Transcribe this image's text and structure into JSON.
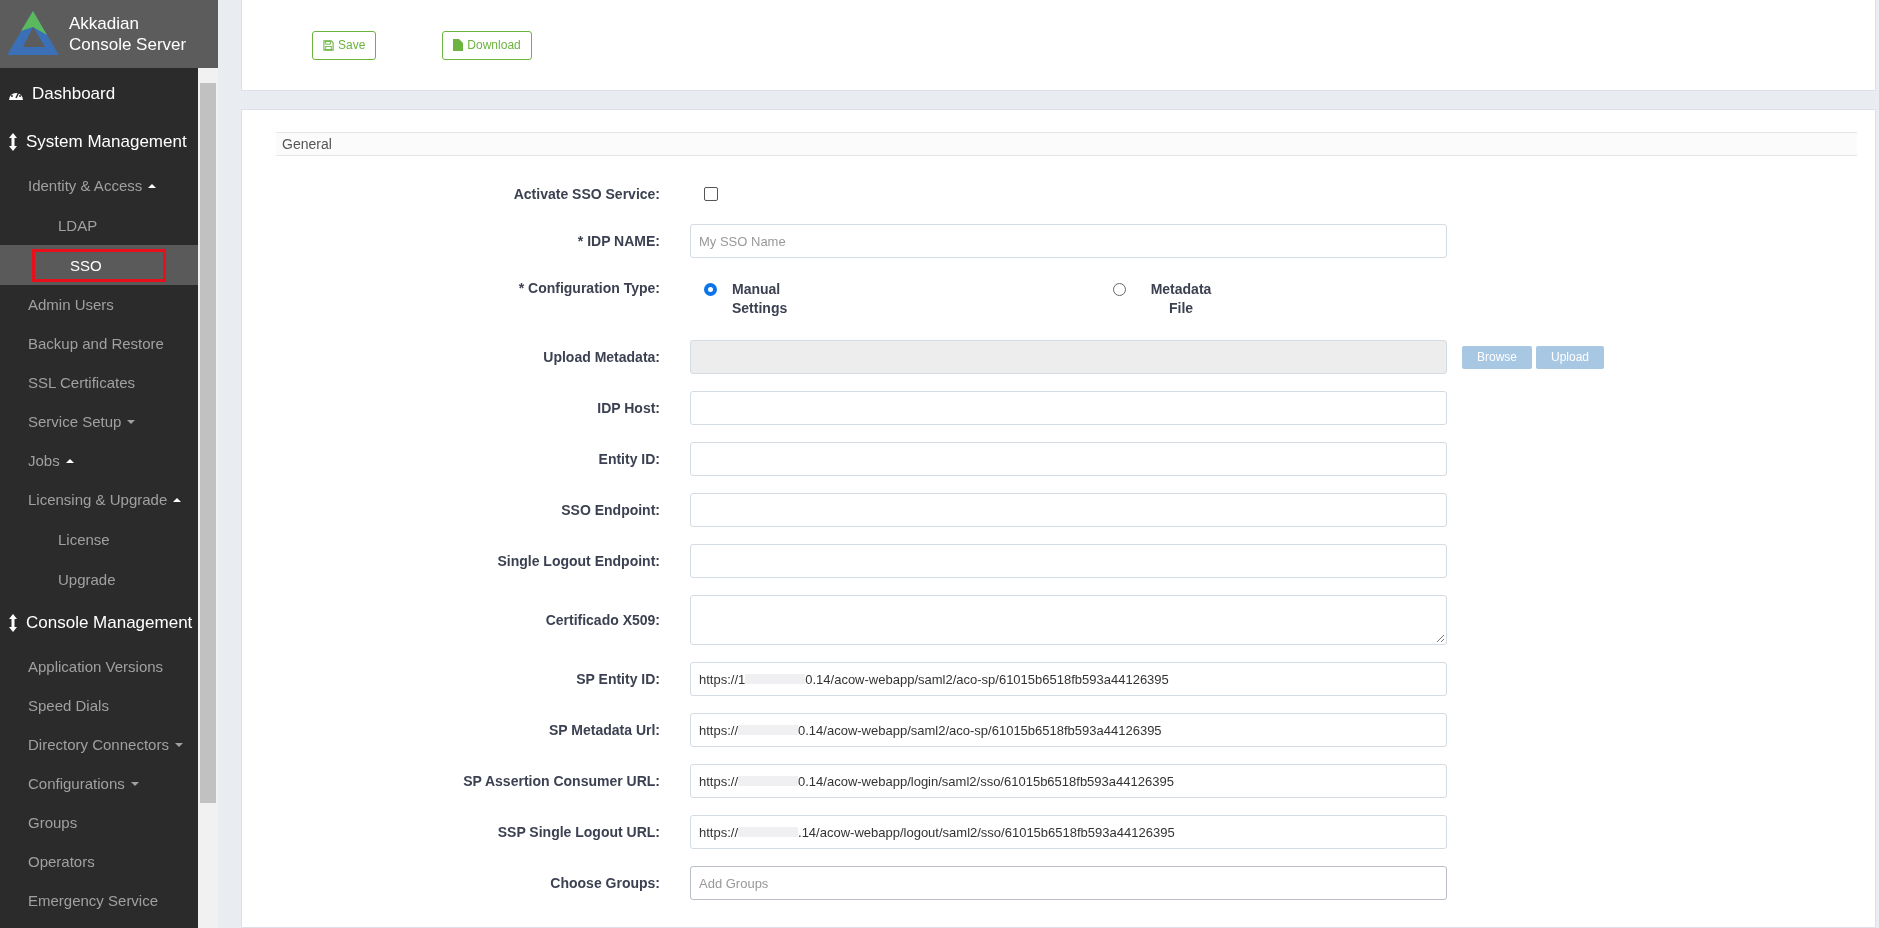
{
  "sidebar": {
    "brand": [
      "Akkadian",
      "Console Server"
    ],
    "items": [
      {
        "label": "Dashboard",
        "kind": "page",
        "selected": false
      },
      {
        "label": "System Management",
        "kind": "section",
        "selected": false,
        "children": [
          {
            "label": "Identity & Access",
            "expanded": true,
            "selected": false,
            "children": [
              {
                "label": "LDAP",
                "selected": false
              },
              {
                "label": "SSO",
                "selected": true
              }
            ]
          },
          {
            "label": "Admin Users",
            "selected": false
          },
          {
            "label": "Backup and Restore",
            "selected": false
          },
          {
            "label": "SSL Certificates",
            "selected": false
          },
          {
            "label": "Service Setup",
            "expanded": false,
            "selected": false
          },
          {
            "label": "Jobs",
            "expanded": true,
            "selected": false
          },
          {
            "label": "Licensing & Upgrade",
            "expanded": true,
            "selected": false,
            "children": [
              {
                "label": "License",
                "selected": false
              },
              {
                "label": "Upgrade",
                "selected": false
              }
            ]
          }
        ]
      },
      {
        "label": "Console Management",
        "kind": "section",
        "selected": false,
        "children": [
          {
            "label": "Application Versions",
            "selected": false
          },
          {
            "label": "Speed Dials",
            "selected": false
          },
          {
            "label": "Directory Connectors",
            "expanded": false,
            "selected": false
          },
          {
            "label": "Configurations",
            "expanded": false,
            "selected": false
          },
          {
            "label": "Groups",
            "selected": false
          },
          {
            "label": "Operators",
            "selected": false
          },
          {
            "label": "Emergency Service",
            "selected": false
          }
        ]
      }
    ]
  },
  "toolbar": {
    "buttons": [
      {
        "label": "Save",
        "kind": "save"
      },
      {
        "label": "Download",
        "kind": "download"
      }
    ]
  },
  "form": {
    "section": "General",
    "rows": [
      {
        "label": "Activate SSO Service:",
        "kind": "checkbox",
        "checked": false
      },
      {
        "label": "* IDP NAME:",
        "kind": "text",
        "placeholder": "My SSO Name"
      },
      {
        "label": "* Configuration Type:",
        "kind": "radio",
        "options": [
          {
            "label": "Manual Settings",
            "selected": true
          },
          {
            "label": "Metadata File",
            "selected": false
          }
        ]
      },
      {
        "label": "Upload Metadata:",
        "kind": "file",
        "buttons": [
          "Browse",
          "Upload"
        ]
      },
      {
        "label": "IDP Host:",
        "kind": "text"
      },
      {
        "label": "Entity ID:",
        "kind": "text"
      },
      {
        "label": "SSO Endpoint:",
        "kind": "text"
      },
      {
        "label": "Single Logout Endpoint:",
        "kind": "text"
      },
      {
        "label": "Certificado X509:",
        "kind": "textarea"
      },
      {
        "label": "SP Entity ID:",
        "kind": "url",
        "value_start": "https://1",
        "value_end": "0.14/acow-webapp/saml2/aco-sp/61015b6518fb593a44126395"
      },
      {
        "label": "SP Metadata Url:",
        "kind": "url",
        "value_start": "https://",
        "value_end": "0.14/acow-webapp/saml2/aco-sp/61015b6518fb593a44126395"
      },
      {
        "label": "SP Assertion Consumer URL:",
        "kind": "url",
        "value_start": "https://",
        "value_end": "0.14/acow-webapp/login/saml2/sso/61015b6518fb593a44126395"
      },
      {
        "label": "SSP Single Logout URL:",
        "kind": "url",
        "value_start": "https://",
        "value_end": ".14/acow-webapp/logout/saml2/sso/61015b6518fb593a44126395"
      },
      {
        "label": "Choose Groups:",
        "kind": "tags",
        "placeholder": "Add Groups"
      }
    ]
  }
}
